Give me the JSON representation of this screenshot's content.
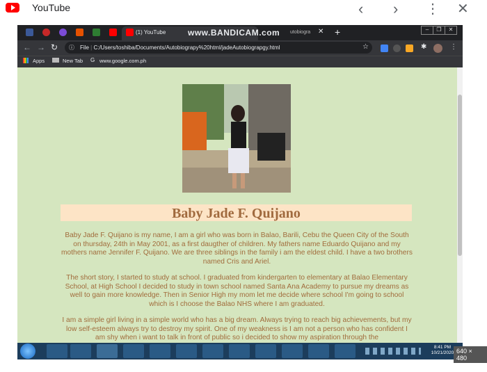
{
  "outer": {
    "title": "YouTube",
    "resolution_badge": "640 × 480"
  },
  "browser": {
    "tab_label": "(1) YouTube",
    "active_tab_title": "jadeAutobiograpy.html",
    "watermark": "www.BANDICAM.com",
    "url_prefix": "File",
    "url": "C:/Users/toshiba/Documents/Autobiograpy%20html/jadeAutobiograpgy.html",
    "bookmarks": [
      "Apps",
      "New Tab",
      "www.google.com.ph"
    ]
  },
  "page": {
    "name": "Baby Jade F. Quijano",
    "paragraphs": [
      "Baby Jade F. Quijano is my name, I am a girl who was born in Balao, Barili, Cebu the Queen City of the South on thursday, 24th in May 2001, as a first daugther of children. My fathers name Eduardo Quijano and my mothers name Jennifer F. Quijano. We are three siblings in the family i am the eldest child. I have a two brothers named Cris and Ariel.",
      "The short story, I started to study at school. I graduated from kindergarten to elementary at Balao Elementary School, at High School I decided to study in town school named Santa Ana Academy to pursue my dreams as well to gain more knowledge. Then in Senior High my mom let me decide where school I'm going to school which is I choose the Balao NHS where I am graduated.",
      "I am a simple girl living in a simple world who has a big dream. Always trying to reach big achievements, but my low self-esteem always try to destroy my spirit. One of my weakness is I am not a person who has confident I am shy when i want to talk in front of public so i decided to show my aspiration through the"
    ]
  },
  "taskbar": {
    "time": "8:41 PM",
    "date": "10/21/2020"
  },
  "colors": {
    "page_bg": "#d5e6bf",
    "name_band": "#fde4c6",
    "text": "#a16c3c"
  }
}
